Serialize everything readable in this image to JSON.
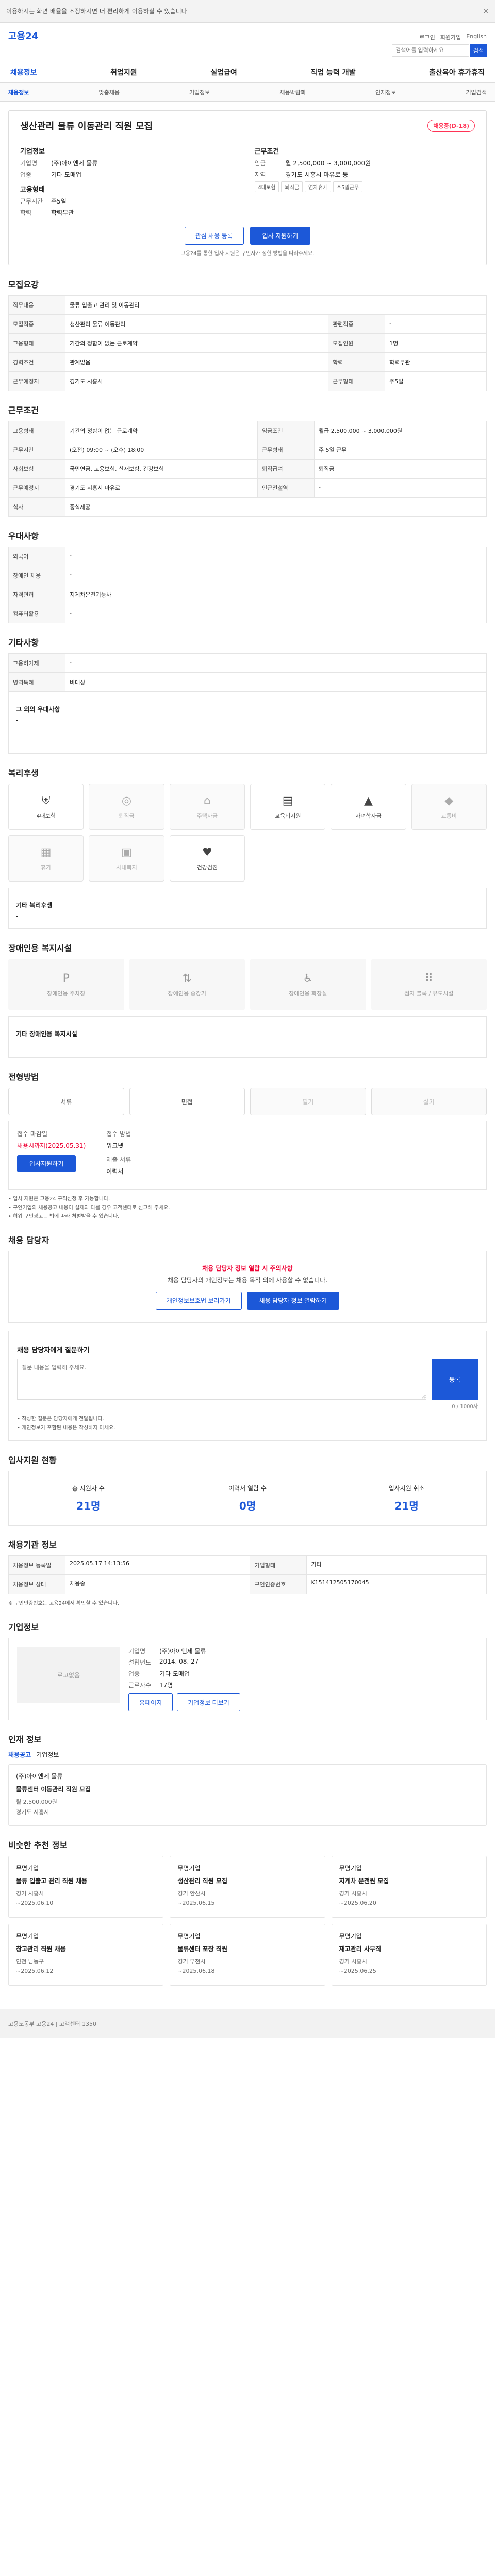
{
  "top_strip": {
    "text": "이용하시는 화면 배율을 조정하시면 더 편리하게 이용하실 수 있습니다",
    "close": "×"
  },
  "brand": {
    "name": "고용24",
    "sub": ""
  },
  "utils": [
    "로그인",
    "회원가입",
    "English"
  ],
  "search": {
    "placeholder": "검색어를 입력하세요",
    "button": "검색"
  },
  "gnb": [
    "채용정보",
    "취업지원",
    "실업급여",
    "직업 능력 개발",
    "출산육아 휴가휴직"
  ],
  "submenu": [
    "채용정보",
    "맞춤채용",
    "기업정보",
    "채용박람회",
    "인재정보",
    "기업검색"
  ],
  "job": {
    "title": "생산관리 물류 이동관리 직원 모집",
    "status": "채용중(D-18)",
    "company_section": "기업정보",
    "company_rows": [
      {
        "k": "기업명",
        "v": "(주)아이앤세 물류"
      },
      {
        "k": "업종",
        "v": "기타 도매업"
      }
    ],
    "work_section": "근무조건",
    "work_rows": [
      {
        "k": "임금",
        "v": "월 2,500,000 ~ 3,000,000원"
      },
      {
        "k": "지역",
        "v": "경기도 시흥시 마유로 등"
      }
    ],
    "hire_section": "고용형태",
    "hire_rows": [
      {
        "k": "근무시간",
        "v": "주5일"
      },
      {
        "k": "학력",
        "v": "학력무관"
      }
    ],
    "tags": [
      "4대보험",
      "퇴직금",
      "연차휴가",
      "주5일근무"
    ],
    "btn_scrap": "관심 채용 등록",
    "btn_apply": "입사 지원하기",
    "notice": "고용24를 통한 입사 지원은 구인자가 정한 방법을 따라주세요."
  },
  "recruit_section": {
    "title": "모집요강",
    "duties_label": "직무내용",
    "duties": "물류 입출고 관리 및 이동관리",
    "rows": [
      {
        "k": "모집직종",
        "v": "생산관리 물류 이동관리",
        "k2": "관련직종",
        "v2": "-"
      },
      {
        "k": "고용형태",
        "v": "기간의 정함이 없는 근로계약",
        "k2": "모집인원",
        "v2": "1명"
      },
      {
        "k": "경력조건",
        "v": "관계없음",
        "k2": "학력",
        "v2": "학력무관"
      },
      {
        "k": "근무예정지",
        "v": "경기도 시흥시",
        "k2": "근무형태",
        "v2": "주5일"
      }
    ]
  },
  "condition_section": {
    "title": "근무조건",
    "rows": [
      {
        "k": "고용형태",
        "v": "기간의 정함이 없는 근로계약",
        "k2": "임금조건",
        "v2": "월급 2,500,000 ~ 3,000,000원"
      },
      {
        "k": "근무시간",
        "v": "(오전) 09:00 ~ (오후) 18:00",
        "k2": "근무형태",
        "v2": "주 5일 근무"
      },
      {
        "k": "사회보험",
        "v": "국민연금, 고용보험, 산재보험, 건강보험",
        "k2": "퇴직급여",
        "v2": "퇴직금"
      },
      {
        "k": "근무예정지",
        "v": "경기도 시흥시 마유로",
        "k2": "인근전철역",
        "v2": "-"
      },
      {
        "k": "식사",
        "v": "중식제공",
        "k2": "",
        "v2": ""
      }
    ]
  },
  "prefer_section": {
    "title": "우대사항",
    "rows": [
      {
        "k": "외국어",
        "v": "-"
      },
      {
        "k": "장애인 채용",
        "v": "-"
      },
      {
        "k": "자격면허",
        "v": "지게차운전기능사"
      },
      {
        "k": "컴퓨터활용",
        "v": "-"
      }
    ]
  },
  "other_section": {
    "title": "기타사항",
    "rows": [
      {
        "k": "고용허가제",
        "v": "-"
      },
      {
        "k": "병역특례",
        "v": "비대상"
      }
    ],
    "extra_label": "그 외의 우대사항",
    "extra": "-"
  },
  "welfare_section": {
    "title": "복리후생",
    "items": [
      {
        "name": "4대보험",
        "icon": "shield-icon",
        "on": true
      },
      {
        "name": "퇴직금",
        "icon": "coin-icon",
        "on": false
      },
      {
        "name": "주택자금",
        "icon": "house-icon",
        "on": false
      },
      {
        "name": "교육비지원",
        "icon": "book-icon",
        "on": true
      },
      {
        "name": "자녀학자금",
        "icon": "cap-icon",
        "on": true
      },
      {
        "name": "교통비",
        "icon": "car-icon",
        "on": false
      },
      {
        "name": "휴가",
        "icon": "calendar-icon",
        "on": false
      },
      {
        "name": "사내복지",
        "icon": "gift-icon",
        "on": false
      },
      {
        "name": "건강검진",
        "icon": "heart-icon",
        "on": true
      }
    ],
    "extra_label": "기타 복리후생",
    "extra": "-"
  },
  "disability_section": {
    "title": "장애인용 복지시설",
    "items": [
      "장애인용 주차장",
      "장애인용 승강기",
      "장애인용 화장실",
      "점자 블록 / 유도시설"
    ],
    "extra_label": "기타 장애인용 복지시설",
    "extra": "-"
  },
  "apply_section": {
    "title": "전형방법",
    "methods": [
      {
        "name": "서류",
        "on": true
      },
      {
        "name": "면접",
        "on": true
      },
      {
        "name": "필기",
        "on": false
      },
      {
        "name": "실기",
        "on": false
      }
    ],
    "deadline_label": "접수 마감일",
    "deadline": "채용시까지(2025.05.31)",
    "method_label": "접수 방법",
    "method": "워크넷",
    "docs_label": "제출 서류",
    "docs": "이력서",
    "apply_btn": "입사지원하기",
    "notices": [
      "• 입사 지원은 고용24 구직신청 후 가능합니다.",
      "• 구인기업의 채용공고 내용이 실제와 다를 경우 고객센터로 신고해 주세요.",
      "• 허위 구인광고는 법에 따라 처벌받을 수 있습니다."
    ]
  },
  "contact_section": {
    "title": "채용 담당자",
    "alert": "채용 담당자 정보 열람 시 주의사항",
    "body": "채용 담당자의 개인정보는 채용 목적 외에 사용할 수 없습니다.",
    "btn_terms": "개인정보보호법 보러가기",
    "btn_view": "채용 담당자 정보 열람하기"
  },
  "qa_section": {
    "title": "채용 담당자에게 질문하기",
    "placeholder": "질문 내용을 입력해 주세요.",
    "count": "0 / 1000자",
    "submit": "등록",
    "notes": [
      "• 작성한 질문은 담당자에게 전달됩니다.",
      "• 개인정보가 포함된 내용은 작성하지 마세요."
    ]
  },
  "stats_section": {
    "title": "입사지원 현황",
    "items": [
      {
        "label": "총 지원자 수",
        "value": "21명"
      },
      {
        "label": "이력서 열람 수",
        "value": "0명"
      },
      {
        "label": "입사지원 취소",
        "value": "21명"
      }
    ]
  },
  "info_section": {
    "title": "채용기관 정보",
    "rows": [
      {
        "k": "채용정보 등록일",
        "v": "2025.05.17 14:13:56",
        "k2": "기업형태",
        "v2": "기타"
      },
      {
        "k": "채용정보 상태",
        "v": "채용중",
        "k2": "구인인증번호",
        "v2": "K151412505170045"
      }
    ],
    "note": "※ 구인인증번호는 고용24에서 확인할 수 있습니다."
  },
  "company_section": {
    "title": "기업정보",
    "logo": "로고없음",
    "rows": [
      {
        "k": "기업명",
        "v": "(주)아이앤세 물류"
      },
      {
        "k": "설립년도",
        "v": "2014. 08. 27"
      },
      {
        "k": "업종",
        "v": "기타 도매업"
      },
      {
        "k": "근로자수",
        "v": "17명"
      }
    ],
    "btn_home": "홈페이지",
    "btn_more": "기업정보 더보기"
  },
  "similar_section": {
    "title": "인재 정보",
    "tabs": [
      "채용공고",
      "기업정보"
    ],
    "company": "(주)아이앤세 물류",
    "post": "물류센터 이동관리 직원 모집",
    "wage": "월 2,500,000원",
    "addr": "경기도 시흥시"
  },
  "recommend_section": {
    "title": "비슷한 추천 정보",
    "cards": [
      {
        "company": "무명기업",
        "title": "물류 입출고 관리 직원 채용",
        "meta": "경기 시흥시",
        "date": "~2025.06.10"
      },
      {
        "company": "무명기업",
        "title": "생산관리 직원 모집",
        "meta": "경기 안산시",
        "date": "~2025.06.15"
      },
      {
        "company": "무명기업",
        "title": "지게차 운전원 모집",
        "meta": "경기 시흥시",
        "date": "~2025.06.20"
      },
      {
        "company": "무명기업",
        "title": "창고관리 직원 채용",
        "meta": "인천 남동구",
        "date": "~2025.06.12"
      },
      {
        "company": "무명기업",
        "title": "물류센터 포장 직원",
        "meta": "경기 부천시",
        "date": "~2025.06.18"
      },
      {
        "company": "무명기업",
        "title": "재고관리 사무직",
        "meta": "경기 시흥시",
        "date": "~2025.06.25"
      }
    ]
  },
  "footer": {
    "text": "고용노동부 고용24 | 고객센터 1350"
  }
}
